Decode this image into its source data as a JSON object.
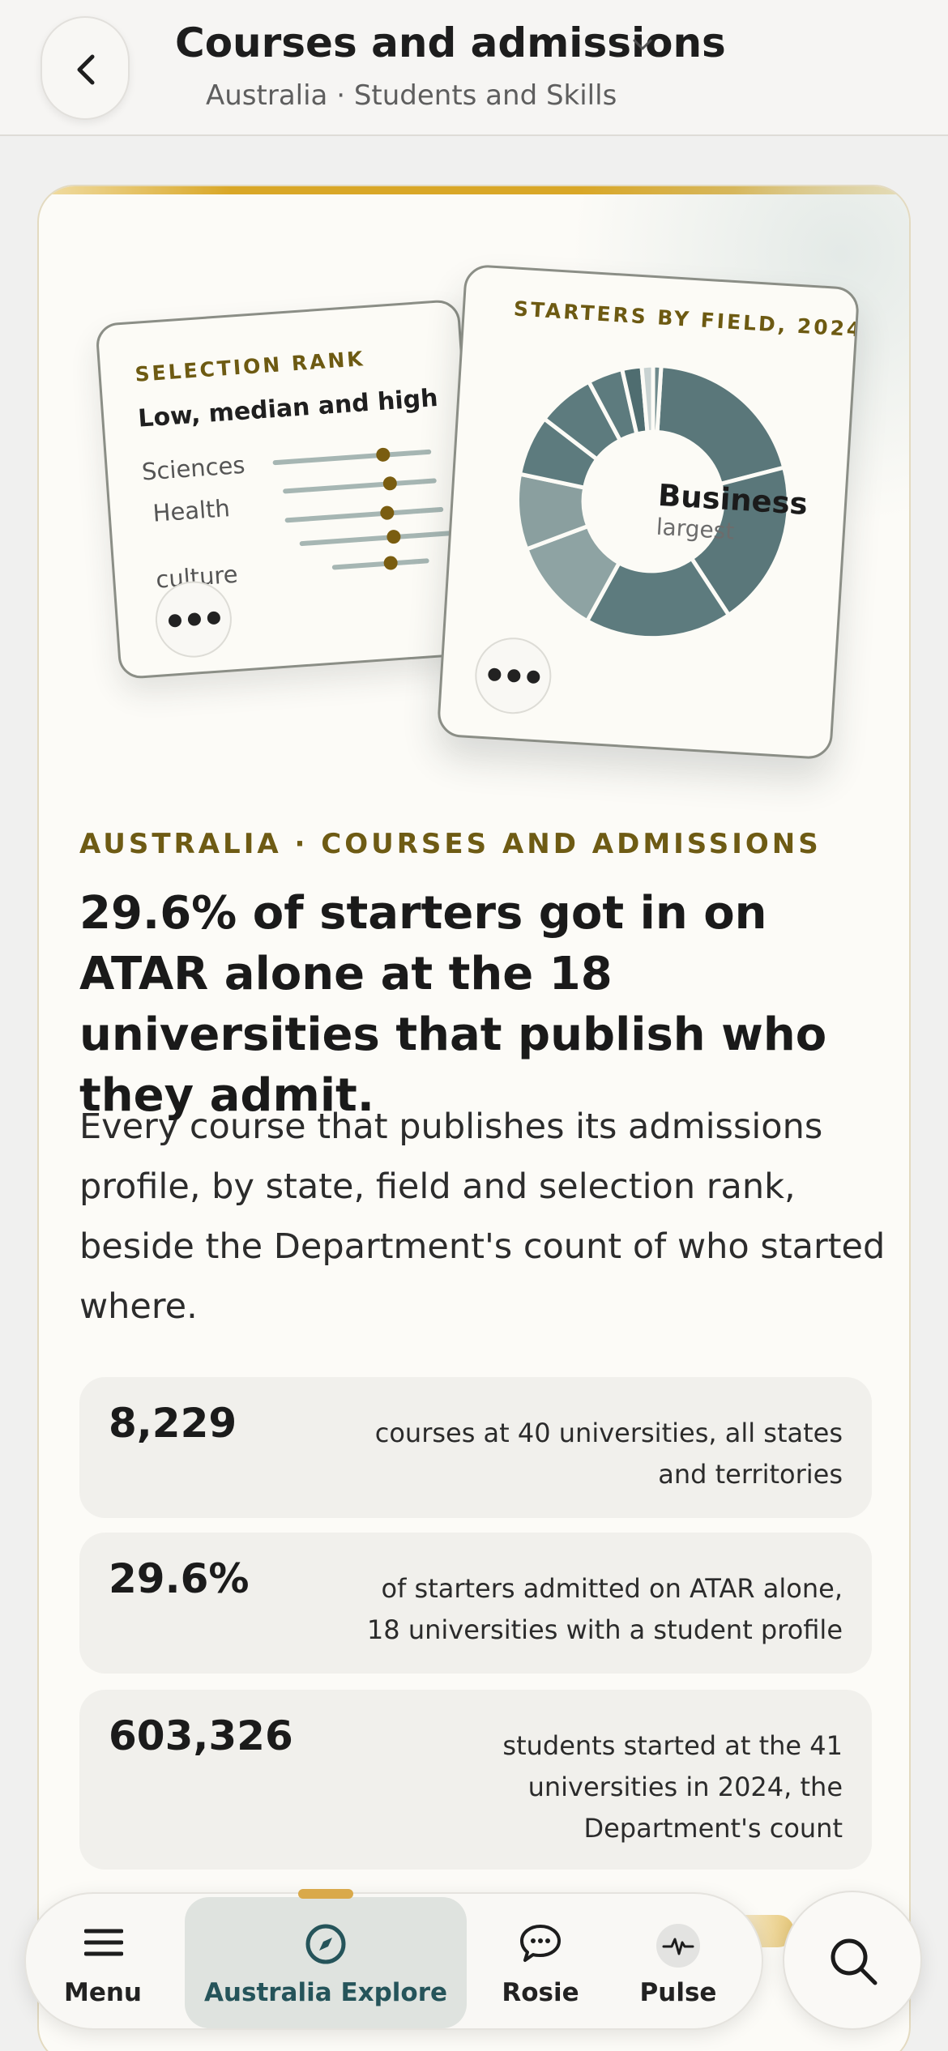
{
  "header": {
    "title": "Courses and admissions",
    "subtitle": "Australia · Students and Skills"
  },
  "preview": {
    "rank_card": {
      "kicker": "SELECTION RANK",
      "subtitle": "Low, median and high",
      "rows": [
        {
          "label": "Sciences"
        },
        {
          "label": "Health"
        },
        {
          "label": "culture"
        }
      ]
    },
    "field_card": {
      "kicker": "STARTERS BY FIELD, 2024",
      "center_label": "Business",
      "center_sub": "largest",
      "accent": "#5a777a"
    }
  },
  "story": {
    "kicker": "AUSTRALIA · COURSES AND ADMISSIONS",
    "headline": "29.6% of starters got in on ATAR alone at the 18 universities that publish who they admit.",
    "lede": "Every course that publishes its admissions profile, by state, field and selection rank, beside the Department's count of who started where."
  },
  "stats": [
    {
      "value": "8,229",
      "desc": "courses at 40 universities, all states and territories"
    },
    {
      "value": "29.6%",
      "desc": "of starters admitted on ATAR alone, 18 universities with a student profile"
    },
    {
      "value": "603,326",
      "desc": "students started at the 41 universities in 2024, the Department's count"
    }
  ],
  "nav": {
    "items": [
      {
        "label": "Menu",
        "icon": "menu-icon"
      },
      {
        "label": "Australia Explore",
        "icon": "compass-icon"
      },
      {
        "label": "Rosie",
        "icon": "chat-bubble-icon"
      },
      {
        "label": "Pulse",
        "icon": "pulse-icon"
      }
    ],
    "active_index": 1
  },
  "colors": {
    "kicker_gold": "#6e5b14",
    "accent_bar": "#d9a727",
    "donut_dark": "#5a777a",
    "donut_light": "#8ea3a3"
  }
}
